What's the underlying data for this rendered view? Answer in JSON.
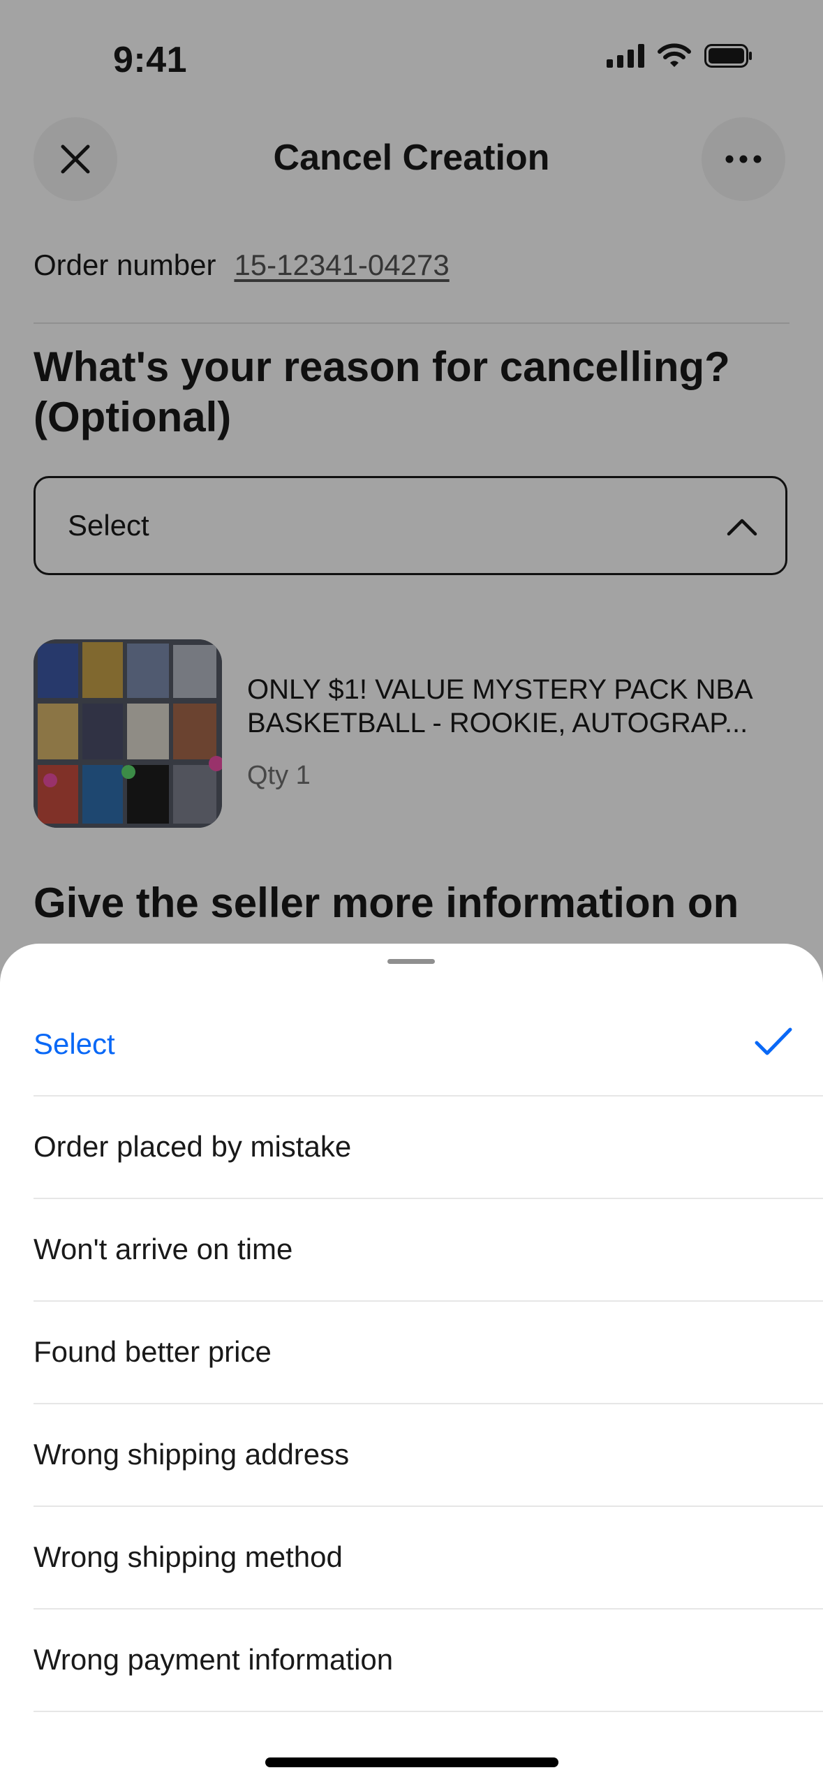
{
  "status_bar": {
    "time": "9:41"
  },
  "header": {
    "title": "Cancel Creation"
  },
  "order": {
    "label": "Order number",
    "number": "15-12341-04273"
  },
  "reason": {
    "heading": "What's your reason for cancelling? (Optional)",
    "select_value": "Select"
  },
  "item": {
    "title_line1": "ONLY $1! VALUE MYSTERY PACK NBA",
    "title_line2": "BASKETBALL - ROOKIE, AUTOGRAP...",
    "qty": "Qty 1"
  },
  "seller_info": {
    "heading": "Give the seller more information on"
  },
  "sheet": {
    "options": [
      {
        "label": "Select",
        "selected": true
      },
      {
        "label": "Order placed by mistake",
        "selected": false
      },
      {
        "label": "Won't arrive on time",
        "selected": false
      },
      {
        "label": "Found better price",
        "selected": false
      },
      {
        "label": "Wrong shipping address",
        "selected": false
      },
      {
        "label": "Wrong shipping method",
        "selected": false
      },
      {
        "label": "Wrong payment information",
        "selected": false
      }
    ]
  },
  "colors": {
    "accent": "#0968f6",
    "text": "#191919",
    "scrim": "rgba(0,0,0,0.36)"
  },
  "icons": [
    "close-icon",
    "more-icon",
    "chevron-up-icon",
    "checkmark-icon",
    "signal-icon",
    "wifi-icon",
    "battery-icon"
  ]
}
